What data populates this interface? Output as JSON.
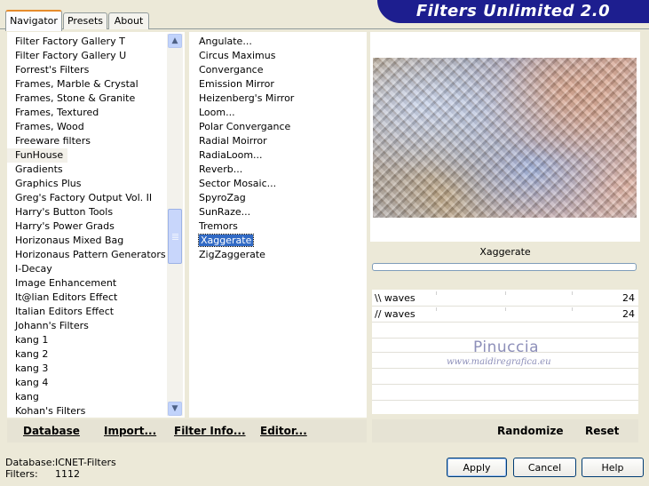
{
  "app": {
    "title": "Filters Unlimited 2.0"
  },
  "tabs": [
    {
      "label": "Navigator",
      "active": true
    },
    {
      "label": "Presets",
      "active": false
    },
    {
      "label": "About",
      "active": false
    }
  ],
  "categories": [
    "Filter Factory Gallery T",
    "Filter Factory Gallery U",
    "Forrest's Filters",
    "Frames, Marble & Crystal",
    "Frames, Stone & Granite",
    "Frames, Textured",
    "Frames, Wood",
    "Freeware filters",
    "FunHouse",
    "Gradients",
    "Graphics Plus",
    "Greg's Factory Output Vol. II",
    "Harry's Button Tools",
    "Harry's Power Grads",
    "Horizonaus Mixed Bag",
    "Horizonaus Pattern Generators",
    "I-Decay",
    "Image Enhancement",
    "It@lian Editors Effect",
    "Italian Editors Effect",
    "Johann's Filters",
    "kang 1",
    "kang 2",
    "kang 3",
    "kang 4",
    "kang",
    "Kohan's Filters"
  ],
  "selected_category": "FunHouse",
  "filters": [
    "Angulate...",
    "Circus Maximus",
    "Convergance",
    "Emission Mirror",
    "Heizenberg's Mirror",
    "Loom...",
    "Polar Convergance",
    "Radial Moirror",
    "RadiaLoom...",
    "Reverb...",
    "Sector Mosaic...",
    "SpyroZag",
    "SunRaze...",
    "Tremors",
    "Xaggerate",
    "ZigZaggerate"
  ],
  "selected_filter": "Xaggerate",
  "preview": {
    "filter_name": "Xaggerate"
  },
  "params": [
    {
      "name": "\\\\ waves",
      "value": "24"
    },
    {
      "name": "// waves",
      "value": "24"
    }
  ],
  "watermark": {
    "name": "Pinuccia",
    "url": "www.maidiregrafica.eu"
  },
  "actions": {
    "database": "Database",
    "import": "Import...",
    "filter_info": "Filter Info...",
    "editor": "Editor...",
    "randomize": "Randomize",
    "reset": "Reset"
  },
  "footer": {
    "database_label": "Database:",
    "database_value": "ICNET-Filters",
    "filters_label": "Filters:",
    "filters_value": "1112"
  },
  "buttons": {
    "apply": "Apply",
    "cancel": "Cancel",
    "help": "Help"
  },
  "icons": {
    "scroll_up": "chevron-up-icon",
    "scroll_down": "chevron-down-icon"
  }
}
